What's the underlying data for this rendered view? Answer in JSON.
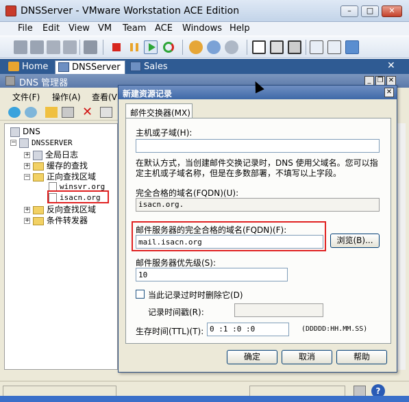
{
  "window": {
    "title": "DNSServer - VMware Workstation ACE Edition",
    "min": "–",
    "max": "□",
    "close": "✕"
  },
  "menubar": [
    "File",
    "Edit",
    "View",
    "VM",
    "Team",
    "ACE",
    "Windows",
    "Help"
  ],
  "tabs": [
    {
      "label": "Home",
      "icon": "home-icon"
    },
    {
      "label": "DNSServer",
      "icon": "vm-icon",
      "active": true
    },
    {
      "label": "Sales",
      "icon": "vm-icon"
    }
  ],
  "tabs_close": "✕",
  "dns": {
    "title": "DNS 管理器",
    "menu": [
      "文件(F)",
      "操作(A)",
      "查看(V)"
    ],
    "tree": {
      "root": "DNS",
      "server": "DNSSERVER",
      "global_log": "全局日志",
      "cache": "缓存的查找",
      "forward": "正向查找区域",
      "zone1": "winsvr.org",
      "zone2": "isacn.org",
      "reverse": "反向查找区域",
      "conditional": "条件转发器"
    },
    "expand_plus": "+",
    "expand_minus": "−"
  },
  "dialog": {
    "title": "新建资源记录",
    "close": "✕",
    "tab": "邮件交换器(MX)",
    "host_label": "主机或子域(H):",
    "host_value": "",
    "info": "在默认方式，当创建邮件交换记录时，DNS 使用父域名。您可以指定主机或子域名称，但是在多数部署，不填写以上字段。",
    "fqdn_label": "完全合格的域名(FQDN)(U):",
    "fqdn_value": "isacn.org.",
    "mail_server_label": "邮件服务器的完全合格的域名(FQDN)(F):",
    "mail_server_value": "mail.isacn.org",
    "browse": "浏览(B)...",
    "priority_label": "邮件服务器优先级(S):",
    "priority_value": "10",
    "delete_stale_label": "当此记录过时时删除它(D)",
    "timestamp_label": "记录时间戳(R):",
    "ttl_label": "生存时间(TTL)(T):",
    "ttl_value": "0        :1  :0  :0",
    "ttl_format": "(DDDDD:HH.MM.SS)",
    "ok": "确定",
    "cancel": "取消",
    "help": "帮助"
  },
  "colors": {
    "accent": "#2f5b93",
    "highlight": "#e02020"
  }
}
